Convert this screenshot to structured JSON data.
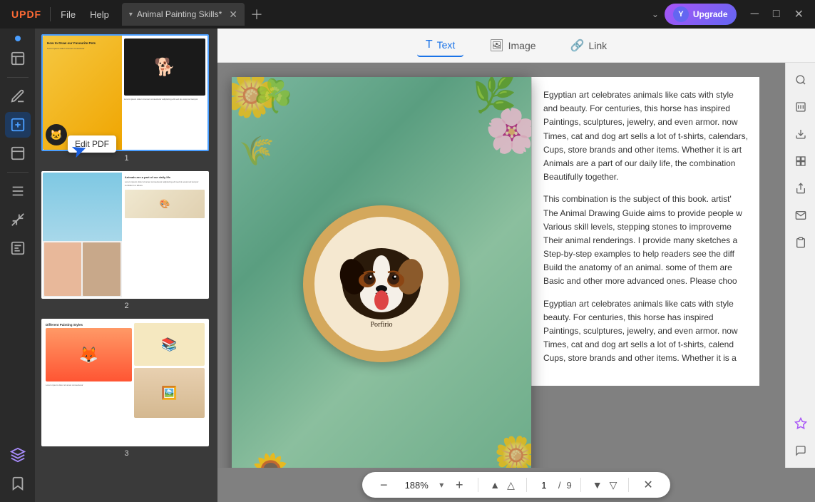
{
  "titlebar": {
    "logo": "UPDF",
    "menu_file": "File",
    "menu_help": "Help",
    "tab_label": "Animal Painting Skills*",
    "upgrade_label": "Upgrade",
    "upgrade_avatar": "Y"
  },
  "toolbar": {
    "text_label": "Text",
    "image_label": "Image",
    "link_label": "Link"
  },
  "tooltip": {
    "label": "Edit PDF"
  },
  "sidebar": {
    "icons": [
      "📄",
      "✏️",
      "🔧",
      "📤",
      "📥",
      "🔖",
      "📑"
    ]
  },
  "thumbnails": [
    {
      "id": 1,
      "label": "1",
      "active": true
    },
    {
      "id": 2,
      "label": "2",
      "active": false
    },
    {
      "id": 3,
      "label": "3",
      "active": false
    }
  ],
  "text_content": {
    "para1": "Egyptian art celebrates animals like cats with style and beauty. For centuries, this horse has inspired Paintings, sculptures, jewelry, and even armor. now Times, cat and dog art sells a lot of t-shirts, calendars, Cups, store brands and other items. Whether it is art Animals are a part of our daily life, the combination Beautifully together.",
    "para2": "This combination is the subject of this book. artist' The Animal Drawing Guide aims to provide people w Various skill levels, stepping stones to improveme Their animal renderings. I provide many sketches a Step-by-step examples to help readers see the diff Build the anatomy of an animal. some of them are Basic and other more advanced ones. Please choo",
    "para3": "Egyptian art celebrates animals like cats with style beauty. For centuries, this horse has inspired Paintings, sculptures, jewelry, and even armor. now Times, cat and dog art sells a lot of t-shirts, calend Cups, store brands and other items. Whether it is a"
  },
  "zoom": {
    "value": "188%",
    "current_page": "1",
    "total_pages": "9"
  },
  "right_sidebar_icons": [
    "🔍",
    "📊",
    "⬆️",
    "⬇️",
    "📤",
    "📧",
    "📋",
    "🎨",
    "💬"
  ]
}
